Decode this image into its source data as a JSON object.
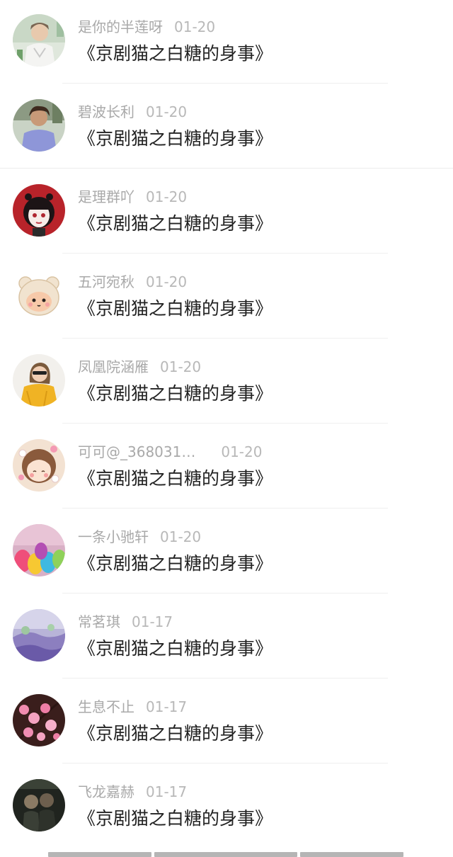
{
  "items": [
    {
      "name": "是你的半莲呀",
      "date": "01-20",
      "title": "《京剧猫之白糖的身事》",
      "avatar": "avatar-boy-white-shirt"
    },
    {
      "name": "碧波长利",
      "date": "01-20",
      "title": "《京剧猫之白糖的身事》",
      "avatar": "avatar-man-blue-shirt"
    },
    {
      "name": "是理群吖",
      "date": "01-20",
      "title": "《京剧猫之白糖的身事》",
      "avatar": "avatar-anime-girl-red"
    },
    {
      "name": "五河宛秋",
      "date": "01-20",
      "title": "《京剧猫之白糖的身事》",
      "avatar": "avatar-cartoon-bear"
    },
    {
      "name": "凤凰院涵雁",
      "date": "01-20",
      "title": "《京剧猫之白糖的身事》",
      "avatar": "avatar-woman-yellow-sweater"
    },
    {
      "name": "可可@_368031…",
      "date": "01-20",
      "title": "《京剧猫之白糖的身事》",
      "avatar": "avatar-anime-girl-flowers"
    },
    {
      "name": "一条小驰轩",
      "date": "01-20",
      "title": "《京剧猫之白糖的身事》",
      "avatar": "avatar-colorful-balloons"
    },
    {
      "name": "常茗琪",
      "date": "01-17",
      "title": "《京剧猫之白糖的身事》",
      "avatar": "avatar-purple-landscape"
    },
    {
      "name": "生息不止",
      "date": "01-17",
      "title": "《京剧猫之白糖的身事》",
      "avatar": "avatar-pink-blossoms"
    },
    {
      "name": "飞龙嘉赫",
      "date": "01-17",
      "title": "《京剧猫之白糖的身事》",
      "avatar": "avatar-dark-couple-photo"
    }
  ]
}
